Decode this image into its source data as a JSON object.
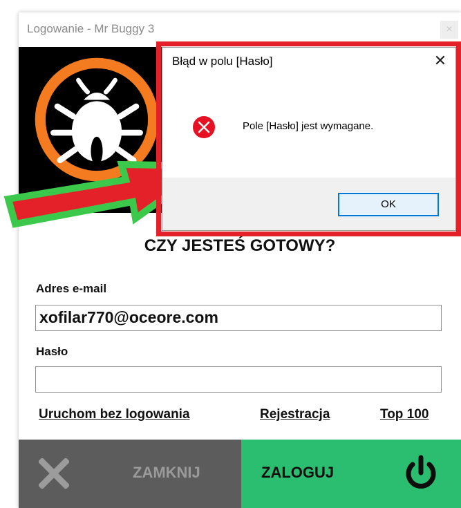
{
  "login_window": {
    "title": "Logowanie - Mr Buggy 3",
    "close_glyph": "×",
    "headline": "CZY JESTEŚ GOTOWY?",
    "email": {
      "label": "Adres e-mail",
      "value": "xofilar770@oceore.com"
    },
    "password": {
      "label": "Hasło",
      "value": ""
    },
    "links": {
      "guest": "Uruchom bez logowania",
      "register": "Rejestracja",
      "top100": "Top 100"
    },
    "buttons": {
      "close_label": "ZAMKNIJ",
      "close_icon": "x-icon",
      "login_label": "ZALOGUJ",
      "login_icon": "power-icon"
    },
    "colors": {
      "login_button": "#2bbd70",
      "close_button": "#5c5c5c",
      "logo_ring": "#f47b20"
    }
  },
  "dialog": {
    "title": "Błąd w polu [Hasło]",
    "close_glyph": "✕",
    "message": "Pole [Hasło] jest wymagane.",
    "ok_label": "OK",
    "icon": "error-icon",
    "highlight_color": "#e42128"
  },
  "annotation": {
    "arrow_color": "#e42128",
    "arrow_outline_color": "#3cc84a"
  }
}
